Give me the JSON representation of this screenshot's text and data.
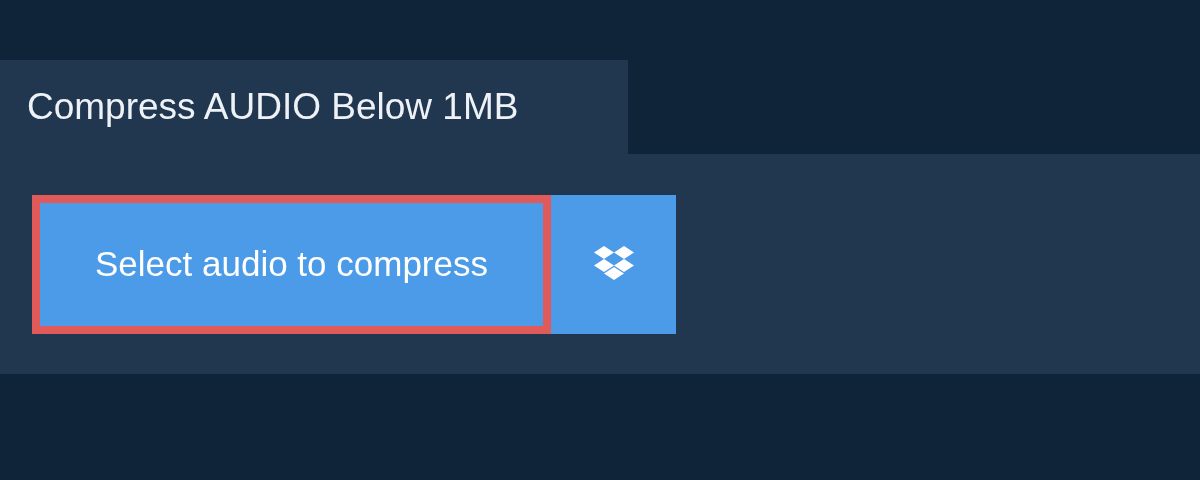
{
  "tab": {
    "title": "Compress AUDIO Below 1MB"
  },
  "select_button": {
    "label": "Select audio to compress"
  }
}
